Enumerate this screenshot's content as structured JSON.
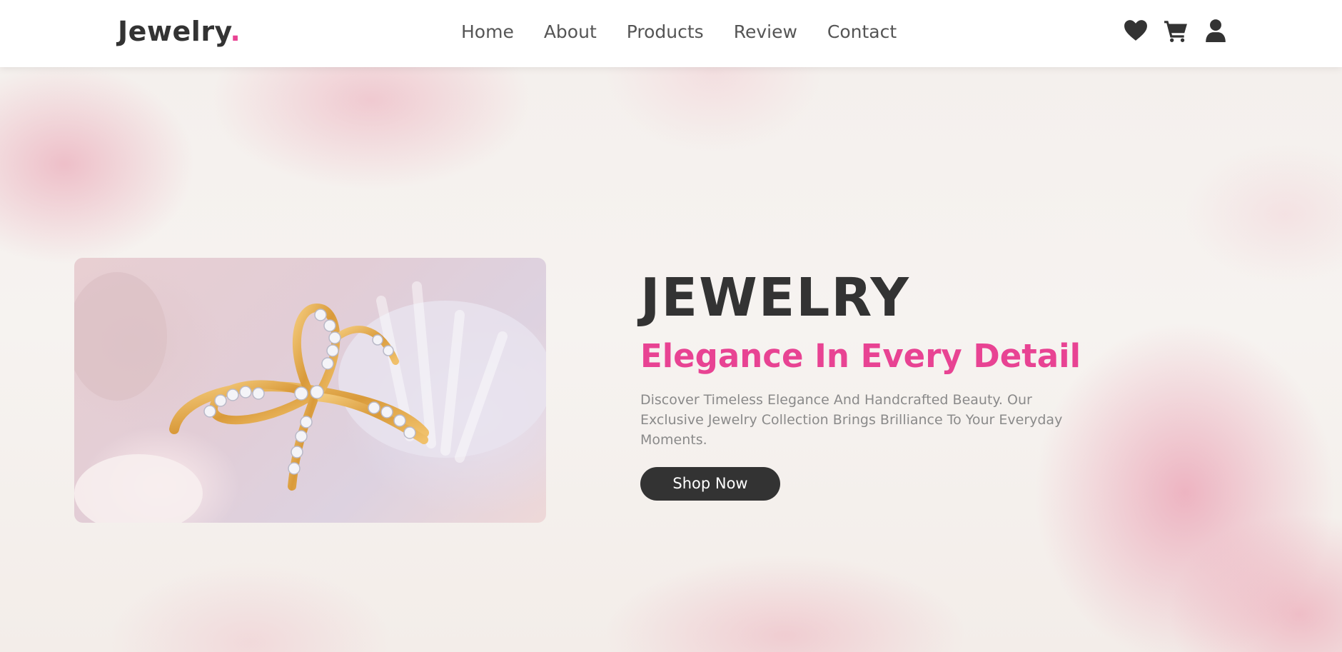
{
  "brand": {
    "name": "Jewelry",
    "dot": ".",
    "accent_color": "#e84393",
    "text_color": "#333333"
  },
  "nav": {
    "items": [
      {
        "label": "Home"
      },
      {
        "label": "About"
      },
      {
        "label": "Products"
      },
      {
        "label": "Review"
      },
      {
        "label": "Contact"
      }
    ]
  },
  "header_icons": [
    "heart-icon",
    "cart-icon",
    "user-icon"
  ],
  "hero": {
    "title": "JEWELRY",
    "subtitle": "Elegance In Every Detail",
    "description": "Discover Timeless Elegance And Handcrafted Beauty. Our Exclusive Jewelry Collection Brings Brilliance To Your Everyday Moments.",
    "cta_label": "Shop Now",
    "image_subject": "gold-diamond-bow-ring"
  }
}
